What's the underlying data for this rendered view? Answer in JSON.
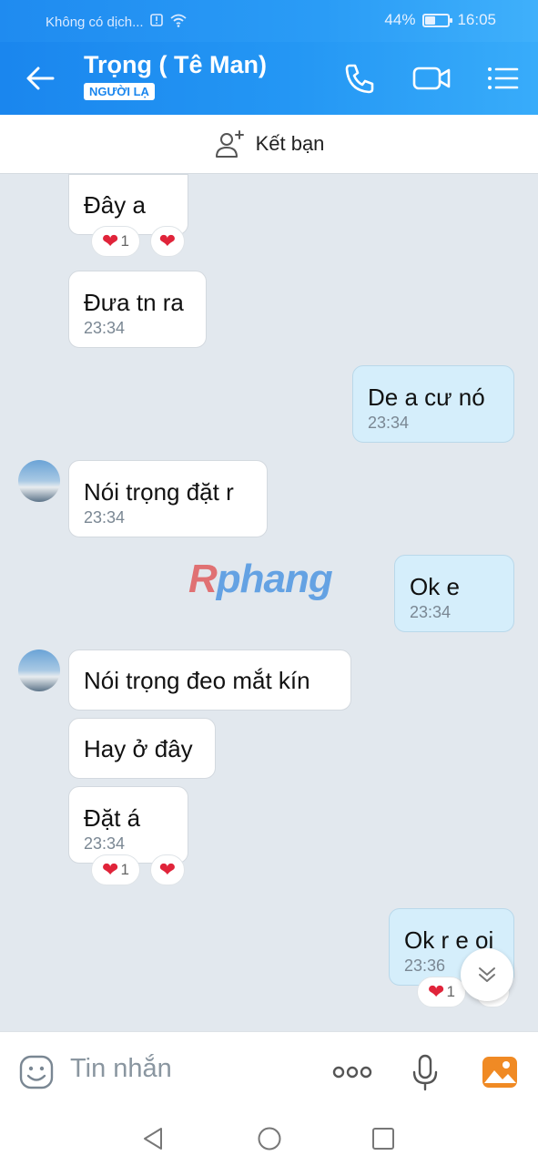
{
  "status": {
    "network": "Không có dịch...",
    "battery": "44%",
    "battery_level": 0.44,
    "time": "16:05"
  },
  "header": {
    "title": "Trọng ( Tê Man)",
    "badge": "NGƯỜI LẠ"
  },
  "add_friend": {
    "label": "Kết bạn"
  },
  "messages": [
    {
      "sender": "other",
      "text": "Đây a",
      "time": "",
      "reaction": "1"
    },
    {
      "sender": "other",
      "text": "Đưa tn ra",
      "time": "23:34"
    },
    {
      "sender": "me",
      "text": "De a cư nó",
      "time": "23:34"
    },
    {
      "sender": "other",
      "text": "Nói trọng đặt r",
      "time": "23:34"
    },
    {
      "sender": "me",
      "text": "Ok e",
      "time": "23:34"
    },
    {
      "sender": "other",
      "text": "Nói trọng đeo mắt kín",
      "time": ""
    },
    {
      "sender": "other",
      "text": "Hay ở đây",
      "time": ""
    },
    {
      "sender": "other",
      "text": "Đặt á",
      "time": "23:34",
      "reaction": "1"
    },
    {
      "sender": "me",
      "text": "Ok r e oi",
      "time": "23:36",
      "reaction": "1"
    }
  ],
  "watermark": {
    "first": "R",
    "rest": "phang"
  },
  "input": {
    "placeholder": "Tin nhắn"
  },
  "icons": {
    "accent": "#1a86ee",
    "heart": "#e0243a",
    "image": "#f08a24"
  }
}
